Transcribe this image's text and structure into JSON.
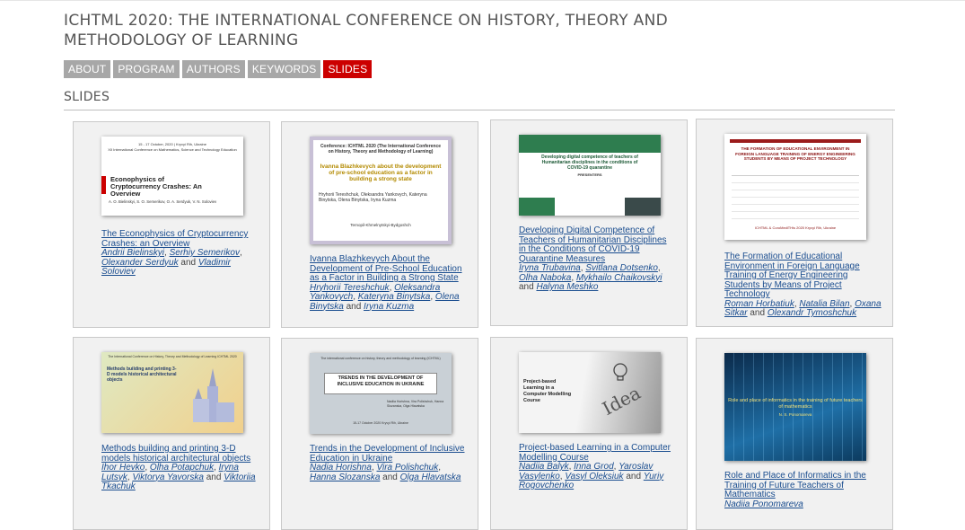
{
  "header": {
    "title": "ICHTML 2020: THE INTERNATIONAL CONFERENCE ON HISTORY, THEORY AND METHODOLOGY OF LEARNING"
  },
  "nav": [
    {
      "label": "ABOUT",
      "active": false
    },
    {
      "label": "PROGRAM",
      "active": false
    },
    {
      "label": "AUTHORS",
      "active": false
    },
    {
      "label": "KEYWORDS",
      "active": false
    },
    {
      "label": "SLIDES",
      "active": true
    }
  ],
  "section_title": "SLIDES",
  "colors": {
    "nav_bg": "#a7a7a7",
    "nav_active": "#cc0000",
    "link": "#1a4d8f"
  },
  "slides": [
    {
      "title": "The Econophysics of Cryptocurrency Crashes: an Overview",
      "authors": [
        "Andrii Bielinskyi",
        "Serhiy Semerikov",
        "Olexander Serdyuk",
        "Vladimir Soloviev"
      ],
      "thumb": {
        "heading": "15 - 17 October, 2020 | Kryvyi Rih, Ukraine",
        "sub": "XII International Conference on Mathematics, Science and Technology Education",
        "main": "Econophysics of Cryptocurrency Crashes: An Overview",
        "names": "A. O. Bielinskyi, S. O. Semerikov, O. A. Serdyuk, V. N. Soloviev"
      }
    },
    {
      "title": "Ivanna Blazhkevych About the Development of Pre-School Education as a Factor in Building a Strong State",
      "authors": [
        "Hryhorii Tereshchuk",
        "Oleksandra Yankovych",
        "Kateryna Binytska",
        "Olena Binytska",
        "Iryna Kuzma"
      ],
      "thumb": {
        "heading": "Conference: ICHTML 2020 (The International Conference on History, Theory and Methodology of Learning)",
        "main": "Ivanna Blazhkevych about the development of pre-school education as a factor in building a strong state",
        "names": "Hryhorii Tereshchuk, Oleksandra Yankovych, Kateryna Binytska, Olena Binytska, Iryna Kuzma",
        "place": "Ternopil-Khmelnytskyi-Bydgoshch"
      }
    },
    {
      "title": "Developing Digital Competence of Teachers of Humanitarian Disciplines in the Conditions of COVID-19 Quarantine Measures",
      "authors": [
        "Iryna Trubavina",
        "Svitlana Dotsenko",
        "Olha Naboka",
        "Mykhailo Chaikovskyi",
        "Halyna Meshko"
      ],
      "thumb": {
        "main": "Developing digital competence of teachers of Humanitarian disciplines in the conditions of COVID-19 quarantine",
        "sub": "PRESENTERS"
      }
    },
    {
      "title": "The Formation of Educational Environment in Foreign Language Training of Energy Engineering Students by Means of Project Technology",
      "authors": [
        "Roman Horbatiuk",
        "Natalia Bilan",
        "Oxana Sitkar",
        "Olexandr Tymoshchuk"
      ],
      "thumb": {
        "main": "THE FORMATION OF EDUCATIONAL ENVIRONMENT IN FOREIGN LANGUAGE TRAINING OF ENERGY ENGINEERING STUDENTS BY MEANS OF PROJECT TECHNOLOGY",
        "foot": "ICHTML & CoroMediTHis 2020 Kryvyi Rih, Ukraine"
      }
    },
    {
      "title": "Methods building and printing 3-D models historical architectural objects",
      "authors": [
        "Ihor Hevko",
        "Olha Potapchuk",
        "Iryna Lutsyk",
        "Viktorya Yavorska",
        "Viktoriia Tkachuk"
      ],
      "thumb": {
        "heading": "The International Conference on History, Theory and Methodology of Learning ICHTML 2020",
        "main": "Methods building and printing 3-D models historical architectural objects"
      }
    },
    {
      "title": "Trends in the Development of Inclusive Education in Ukraine",
      "authors": [
        "Nadia Horishna",
        "Vira Polishchuk",
        "Hanna Slozanska",
        "Olga Hlavatska"
      ],
      "thumb": {
        "heading": "The international conference on history, theory and methodology of learning (ICHTML)",
        "main": "TRENDS IN THE DEVELOPMENT OF INCLUSIVE EDUCATION IN UKRAINE",
        "names": "Nadiia Horishna, Vira Polishchuk, Hanna Slozanska, Olga Hlavatska",
        "foot": "15-17 October 2020 Kryvyi Rih, Ukraine"
      }
    },
    {
      "title": "Project-based Learning in a Computer Modelling Course",
      "authors": [
        "Nadiia Balyk",
        "Inna Grod",
        "Yaroslav Vasylenko",
        "Vasyl Oleksiuk",
        "Yuriy Rogovchenko"
      ],
      "thumb": {
        "main": "Project-based Learning in a Computer Modelling Course",
        "word": "Idea"
      }
    },
    {
      "title": "Role and Place of Informatics in the Training of Future Teachers of Mathematics",
      "authors": [
        "Nadiia Ponomareva"
      ],
      "thumb": {
        "main": "Role and place of informatics in the training of future teachers of mathematics",
        "names": "N. S. Ponomareva"
      }
    }
  ]
}
